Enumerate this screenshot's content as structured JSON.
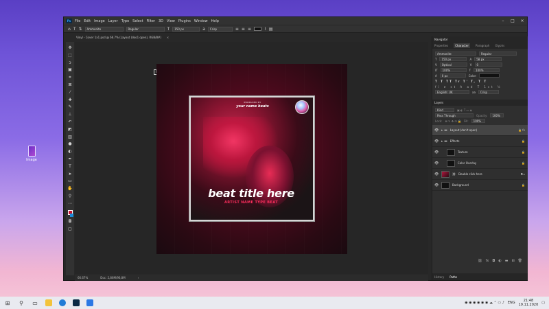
{
  "desktop": {
    "icon_label": "Image"
  },
  "app": {
    "menu": [
      "File",
      "Edit",
      "Image",
      "Layer",
      "Type",
      "Select",
      "Filter",
      "3D",
      "View",
      "Plugins",
      "Window",
      "Help"
    ],
    "logo": "Ps"
  },
  "options_bar": {
    "font_family": "Ammonite",
    "font_style": "Regular",
    "font_size": "150 px",
    "antialias": "Crisp"
  },
  "document_tab": {
    "title": "Vinyl - Cover 1x1.psd @ 66.7% (Layout (doo1 open), RGB/8#)"
  },
  "cover": {
    "pre_text": "PRODUCED BY",
    "brand": "your name beats",
    "title": "beat title here",
    "subtitle": "ARTIST NAME TYPE BEAT"
  },
  "status": {
    "zoom": "66.67%",
    "doc": "Doc: 2,86M/96,8M"
  },
  "navigator": {
    "header": "Navigator"
  },
  "character": {
    "tabs": [
      "Properties",
      "Character",
      "Paragraph",
      "Glyphs"
    ],
    "active_tab": "Character",
    "font_family": "Ammonite",
    "font_style": "Regular",
    "size": "150 px",
    "leading": "58 px",
    "kerning": "Optical",
    "tracking": "0",
    "vscale": "100%",
    "hscale": "100%",
    "baseline": "0 px",
    "color_label": "Color:",
    "language": "English: UK",
    "antialias_short": "aa",
    "antialias": "Crisp"
  },
  "layers": {
    "header": "Layers",
    "kind": "Kind",
    "blend": "Pass Through",
    "opacity_label": "Opacity:",
    "opacity": "100%",
    "lock_label": "Lock:",
    "fill_label": "Fill:",
    "fill": "100%",
    "items": [
      {
        "name": "Layout (don't open)"
      },
      {
        "name": "Effects"
      },
      {
        "name": "Texture"
      },
      {
        "name": "Color Overlay"
      },
      {
        "name": "Double click here"
      },
      {
        "name": "Background"
      }
    ]
  },
  "bottom_tabs": [
    "History",
    "Paths"
  ],
  "taskbar": {
    "language": "ENG",
    "time": "21:48",
    "date": "19.11.2020"
  }
}
